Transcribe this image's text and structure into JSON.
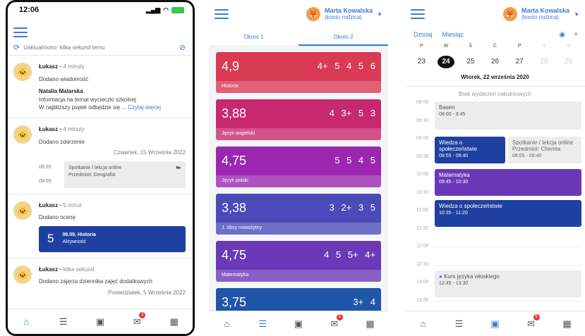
{
  "phone1": {
    "time": "12:06",
    "refresh_text": "Uaktualniono: kilka sekund temu",
    "feed": [
      {
        "author": "Łukasz",
        "ago": "• 4 minuty",
        "action": "Dodano wiadomość",
        "sender": "Natalia Malarska",
        "subject": "Informacja na temat wycieczki szkolnej",
        "preview": "W najbliższy piątek odbędzie się ...",
        "link": "Czytaj więcej"
      },
      {
        "author": "Łukasz",
        "ago": "• 4 minuty",
        "action": "Dodano zdarzenie",
        "date": "Czwartek, 15 Września 2022",
        "start": "08:20",
        "end": "09:05",
        "event_title": "Spotkanie / lekcja online",
        "event_sub": "Przedmiot: Geografia"
      },
      {
        "author": "Łukasz",
        "ago": "• 5 minut",
        "action": "Dodano ocenę",
        "grade": "5",
        "grade_title": "08.09, Historia",
        "grade_sub": "Aktywność"
      },
      {
        "author": "Łukasz",
        "ago": "• kilka sekund",
        "action": "Dodano zajęcia dziennika zajęć dodatkowych",
        "date": "Poniedziałek, 5 Września 2022"
      }
    ],
    "badge": "2"
  },
  "header": {
    "name": "Marta Kowalska",
    "role": "(konto rodzica)"
  },
  "phone2": {
    "tabs": [
      "Okres 1",
      "Okres 2"
    ],
    "subjects": [
      {
        "avg": "4,9",
        "grades": "4+ 5 4 5 6",
        "name": "Historia",
        "color": "#d93a54"
      },
      {
        "avg": "3,88",
        "grades": "4 3+ 5 3",
        "name": "Język angielski",
        "color": "#c8296e"
      },
      {
        "avg": "4,75",
        "grades": "5 5 4 5",
        "name": "Język polski",
        "color": "#9b27b0"
      },
      {
        "avg": "3,38",
        "grades": "3 2+ 3 5",
        "name": "J. obcy nowożytny",
        "color": "#4a4bb8"
      },
      {
        "avg": "4,75",
        "grades": "4 5 5+ 4+",
        "name": "Matematyka",
        "color": "#6b38b8"
      },
      {
        "avg": "3,75",
        "grades": "3+ 4",
        "name": "",
        "color": "#1f56a8"
      }
    ],
    "badge": "5"
  },
  "phone3": {
    "today": "Dzisiaj",
    "view": "Miesiąc",
    "weekdays": [
      "P",
      "W",
      "Ś",
      "C",
      "P",
      "S",
      "N"
    ],
    "days": [
      "23",
      "24",
      "25",
      "26",
      "27",
      "28",
      "29"
    ],
    "selected_date": "Wtorek, 22 września 2020",
    "allday": "Brak wydarzeń całodniowych",
    "hours": [
      "08:00",
      "08:30",
      "09:00",
      "09:30",
      "10:00",
      "10:30",
      "11:00",
      "11:30",
      "12:00",
      "12:30",
      "13:00",
      "13:30"
    ],
    "events": [
      {
        "title": "Basen",
        "time": "08:00 - 8:45"
      },
      {
        "title": "Wiedza o społeczeństwie",
        "time": "08:55 - 09:40"
      },
      {
        "title": "Spotkanie / lekcja online Przedmiot: Chemia",
        "time": "08:55 - 09:40"
      },
      {
        "title": "Matematyka",
        "time": "09:45 - 10:30"
      },
      {
        "title": "Wiedza o społeczeństwie",
        "time": "10:35 - 11:20"
      },
      {
        "title": "Kurs języka włoskiego",
        "time": "12:45 - 13:30"
      }
    ],
    "badge": "5"
  },
  "colors": {
    "accent": "#3a7bd5",
    "navy": "#1e40a0",
    "purple": "#6b38b8"
  }
}
